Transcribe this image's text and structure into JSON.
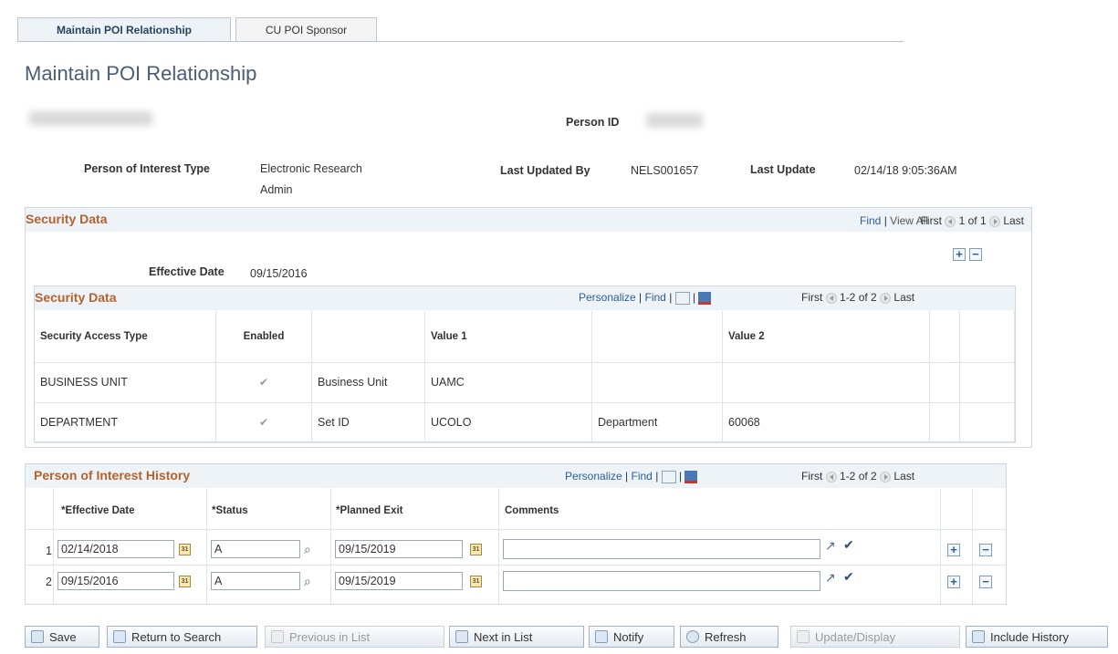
{
  "tabs": [
    {
      "label": "Maintain POI Relationship",
      "active": true
    },
    {
      "label": "CU POI Sponsor",
      "active": false
    }
  ],
  "page_title": "Maintain POI Relationship",
  "header": {
    "person_id_label": "Person ID",
    "poi_type_label": "Person of Interest Type",
    "poi_type_value_line1": "Electronic Research",
    "poi_type_value_line2": "Admin",
    "last_updated_by_label": "Last Updated By",
    "last_updated_by_value": "NELS001657",
    "last_update_label": "Last Update",
    "last_update_value": "02/14/18  9:05:36AM"
  },
  "security_outer": {
    "title": "Security Data",
    "find": "Find",
    "sep": "|",
    "view_all": "View All",
    "first": "First",
    "range": "1 of 1",
    "last": "Last",
    "add": "+",
    "remove": "−",
    "effective_date_label": "Effective Date",
    "effective_date_value": "09/15/2016"
  },
  "security_grid": {
    "title": "Security Data",
    "personalize": "Personalize",
    "find": "Find",
    "sep": "|",
    "first": "First",
    "range": "1-2 of 2",
    "last": "Last",
    "columns": [
      "Security Access Type",
      "Enabled",
      "",
      "Value 1",
      "",
      "Value 2"
    ],
    "rows": [
      {
        "type": "BUSINESS UNIT",
        "enabled": "✔",
        "label1": "Business Unit",
        "value1": "UAMC",
        "label2": "",
        "value2": ""
      },
      {
        "type": "DEPARTMENT",
        "enabled": "✔",
        "label1": "Set ID",
        "value1": "UCOLO",
        "label2": "Department",
        "value2": "60068"
      }
    ]
  },
  "history_grid": {
    "title": "Person of Interest History",
    "personalize": "Personalize",
    "find": "Find",
    "sep": "|",
    "first": "First",
    "range": "1-2 of 2",
    "last": "Last",
    "columns": [
      "*Effective Date",
      "*Status",
      "*Planned Exit",
      "Comments"
    ],
    "rows": [
      {
        "num": "1",
        "effective_date": "02/14/2018",
        "status": "A",
        "planned_exit": "09/15/2019",
        "comments": ""
      },
      {
        "num": "2",
        "effective_date": "09/15/2016",
        "status": "A",
        "planned_exit": "09/15/2019",
        "comments": ""
      }
    ],
    "add": "+",
    "remove": "−"
  },
  "toolbar": {
    "save": "Save",
    "return_to_search": "Return to Search",
    "previous_in_list": "Previous in List",
    "next_in_list": "Next in List",
    "notify": "Notify",
    "refresh": "Refresh",
    "update_display": "Update/Display",
    "include_history": "Include History"
  },
  "icons": {
    "calendar": "31",
    "search": "search-icon"
  },
  "colors": {
    "section_title": "#b5622c",
    "link": "#2b5e93",
    "header_bg": "#eef3f8"
  }
}
